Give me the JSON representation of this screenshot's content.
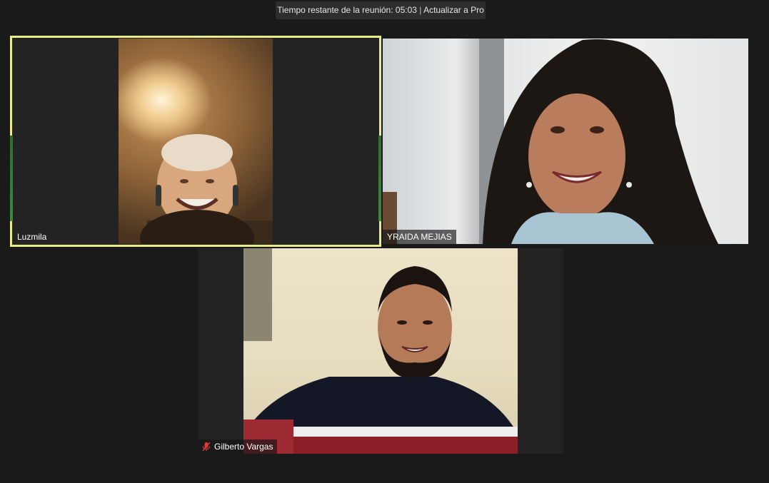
{
  "banner": {
    "prefix": "Tiempo restante de la reunión:",
    "time": "05:03",
    "separator": "|",
    "upgrade_link": "Actualizar a Pro"
  },
  "participants": [
    {
      "name": "Luzmila",
      "muted": false,
      "active_speaker": true
    },
    {
      "name": "YRAIDA MEJIAS",
      "muted": false,
      "active_speaker": false
    },
    {
      "name": "Gilberto Vargas",
      "muted": true,
      "active_speaker": false
    }
  ],
  "icons": {
    "muted": "muted-microphone-icon"
  },
  "colors": {
    "background": "#1a1a1a",
    "active_speaker_border": "#e8ec8a",
    "muted_icon": "#e03a3a",
    "banner_bg": "#2d2d2d"
  }
}
